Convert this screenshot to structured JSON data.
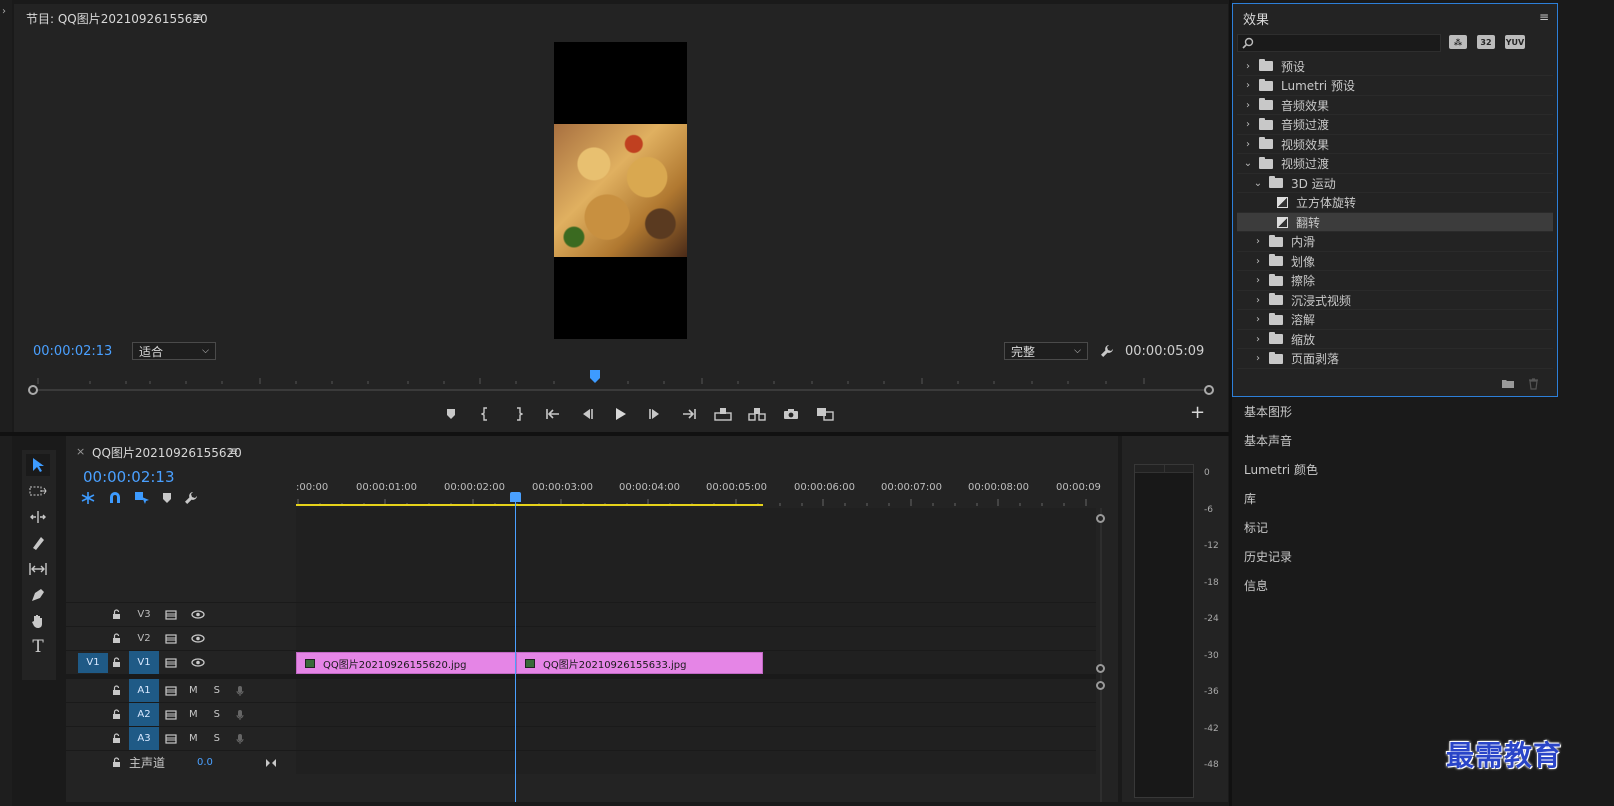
{
  "program": {
    "title": "节目: QQ图片20210926155620",
    "menu": "≡",
    "timecode_current": "00:00:02:13",
    "fit_select": "适合",
    "quality_select": "完整",
    "timecode_duration": "00:00:05:09"
  },
  "effects": {
    "title": "效果",
    "menu": "≡",
    "badges": [
      "⁂",
      "32",
      "YUV"
    ],
    "tree": [
      {
        "label": "预设",
        "expanded": false,
        "level": 0,
        "type": "preset-folder"
      },
      {
        "label": "Lumetri 预设",
        "expanded": false,
        "level": 0,
        "type": "preset-folder"
      },
      {
        "label": "音频效果",
        "expanded": false,
        "level": 0,
        "type": "folder"
      },
      {
        "label": "音频过渡",
        "expanded": false,
        "level": 0,
        "type": "folder"
      },
      {
        "label": "视频效果",
        "expanded": false,
        "level": 0,
        "type": "folder"
      },
      {
        "label": "视频过渡",
        "expanded": true,
        "level": 0,
        "type": "folder"
      },
      {
        "label": "3D 运动",
        "expanded": true,
        "level": 1,
        "type": "folder"
      },
      {
        "label": "立方体旋转",
        "level": 2,
        "type": "transition"
      },
      {
        "label": "翻转",
        "level": 2,
        "type": "transition",
        "selected": true
      },
      {
        "label": "内滑",
        "expanded": false,
        "level": 1,
        "type": "folder"
      },
      {
        "label": "划像",
        "expanded": false,
        "level": 1,
        "type": "folder"
      },
      {
        "label": "擦除",
        "expanded": false,
        "level": 1,
        "type": "folder"
      },
      {
        "label": "沉浸式视频",
        "expanded": false,
        "level": 1,
        "type": "folder"
      },
      {
        "label": "溶解",
        "expanded": false,
        "level": 1,
        "type": "folder"
      },
      {
        "label": "缩放",
        "expanded": false,
        "level": 1,
        "type": "folder"
      },
      {
        "label": "页面剥落",
        "expanded": false,
        "level": 1,
        "type": "folder"
      }
    ]
  },
  "right_tabs": [
    "基本图形",
    "基本声音",
    "Lumetri 颜色",
    "库",
    "标记",
    "历史记录",
    "信息"
  ],
  "timeline": {
    "close": "×",
    "title": "QQ图片20210926155620",
    "menu": "≡",
    "timecode": "00:00:02:13",
    "ruler_labels": [
      ":00:00",
      "00:00:01:00",
      "00:00:02:00",
      "00:00:03:00",
      "00:00:04:00",
      "00:00:05:00",
      "00:00:06:00",
      "00:00:07:00",
      "00:00:08:00",
      "00:00:09"
    ],
    "tracks": {
      "v3": {
        "label": "V3"
      },
      "v2": {
        "label": "V2"
      },
      "v1": {
        "source": "V1",
        "label": "V1"
      },
      "a1": {
        "label": "A1",
        "m": "M",
        "s": "S"
      },
      "a2": {
        "label": "A2",
        "m": "M",
        "s": "S"
      },
      "a3": {
        "label": "A3",
        "m": "M",
        "s": "S"
      },
      "master": {
        "label": "主声道",
        "value": "0.0"
      }
    },
    "clips": [
      {
        "name": "QQ图片20210926155620.jpg"
      },
      {
        "name": "QQ图片20210926155633.jpg"
      }
    ]
  },
  "meter": {
    "db_labels": [
      "0",
      "-6",
      "-12",
      "-18",
      "-24",
      "-30",
      "-36",
      "-42",
      "-48"
    ]
  },
  "watermark": "最需教育",
  "colors": {
    "accent": "#4aa0ff",
    "clip": "#e585e6",
    "work_area": "#e6d21a",
    "panel_focus": "#2d7fd8"
  }
}
